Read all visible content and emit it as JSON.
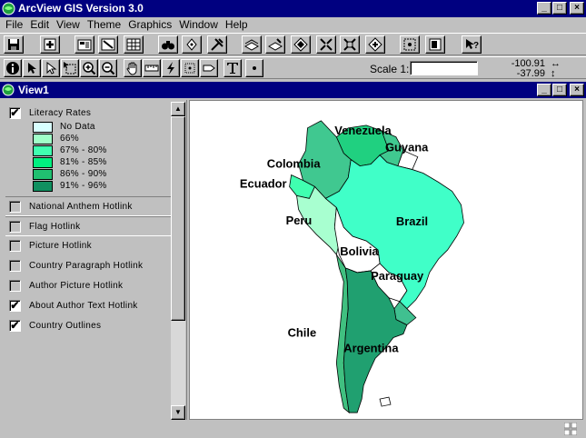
{
  "app": {
    "title": "ArcView GIS Version 3.0"
  },
  "window_buttons": {
    "minimize": "_",
    "maximize": "□",
    "close": "×"
  },
  "menu": [
    "File",
    "Edit",
    "View",
    "Theme",
    "Graphics",
    "Window",
    "Help"
  ],
  "toolbar_icons": [
    "save-icon",
    "add-theme-icon",
    "theme-properties-icon",
    "edit-legend-icon",
    "open-table-icon",
    "find-icon",
    "locate-address-icon",
    "query-builder-icon",
    "zoom-full-extent-icon",
    "zoom-active-themes-icon",
    "zoom-selected-icon",
    "zoom-in-icon",
    "zoom-out-icon",
    "zoom-previous-icon",
    "select-by-theme-icon",
    "layout-icon",
    "help-icon"
  ],
  "tool_icons": [
    "identify-icon",
    "pointer-icon",
    "vertex-edit-icon",
    "select-feature-icon",
    "zoom-in-tool-icon",
    "zoom-out-tool-icon",
    "pan-icon",
    "measure-icon",
    "hotlink-icon",
    "area-of-interest-icon",
    "label-icon",
    "text-icon",
    "draw-point-icon"
  ],
  "scale": {
    "label": "Scale 1:",
    "value": ""
  },
  "coords": {
    "x": "-100.91",
    "y": "-37.99"
  },
  "view": {
    "title": "View1"
  },
  "themes": [
    {
      "label": "Literacy Rates",
      "checked": true
    },
    {
      "label": "National Anthem Hotlink",
      "checked": false
    },
    {
      "label": "Flag Hotlink",
      "checked": false
    },
    {
      "label": "Picture Hotlink",
      "checked": false
    },
    {
      "label": "Country Paragraph Hotlink",
      "checked": false
    },
    {
      "label": "Author Picture Hotlink",
      "checked": false
    },
    {
      "label": "About Author Text Hotlink",
      "checked": true
    },
    {
      "label": "Country Outlines",
      "checked": true
    }
  ],
  "legend": [
    {
      "label": "No Data",
      "color": "#d8ffff"
    },
    {
      "label": "66%",
      "color": "#a0ffc8"
    },
    {
      "label": "67% - 80%",
      "color": "#40ffb0"
    },
    {
      "label": "81% - 85%",
      "color": "#00f080"
    },
    {
      "label": "86% - 90%",
      "color": "#20c070"
    },
    {
      "label": "91% - 96%",
      "color": "#109060"
    }
  ],
  "map_labels": {
    "venezuela": "Venezuela",
    "guyana": "Guyana",
    "colombia": "Colombia",
    "ecuador": "Ecuador",
    "peru": "Peru",
    "brazil": "Brazil",
    "bolivia": "Bolivia",
    "paraguay": "Paraguay",
    "chile": "Chile",
    "argentina": "Argentina"
  },
  "colors": {
    "titlebar": "#000080",
    "chrome": "#c0c0c0",
    "brazil": "#40ffc8",
    "argentina": "#20a070",
    "chile": "#40c080",
    "peru": "#a8ffd0",
    "colombia": "#40c890",
    "venezuela": "#20d080",
    "bolivia": "#ffffff",
    "paraguay": "#ffffff",
    "uruguay": "#40c090",
    "ecuador": "#40ffb0"
  }
}
